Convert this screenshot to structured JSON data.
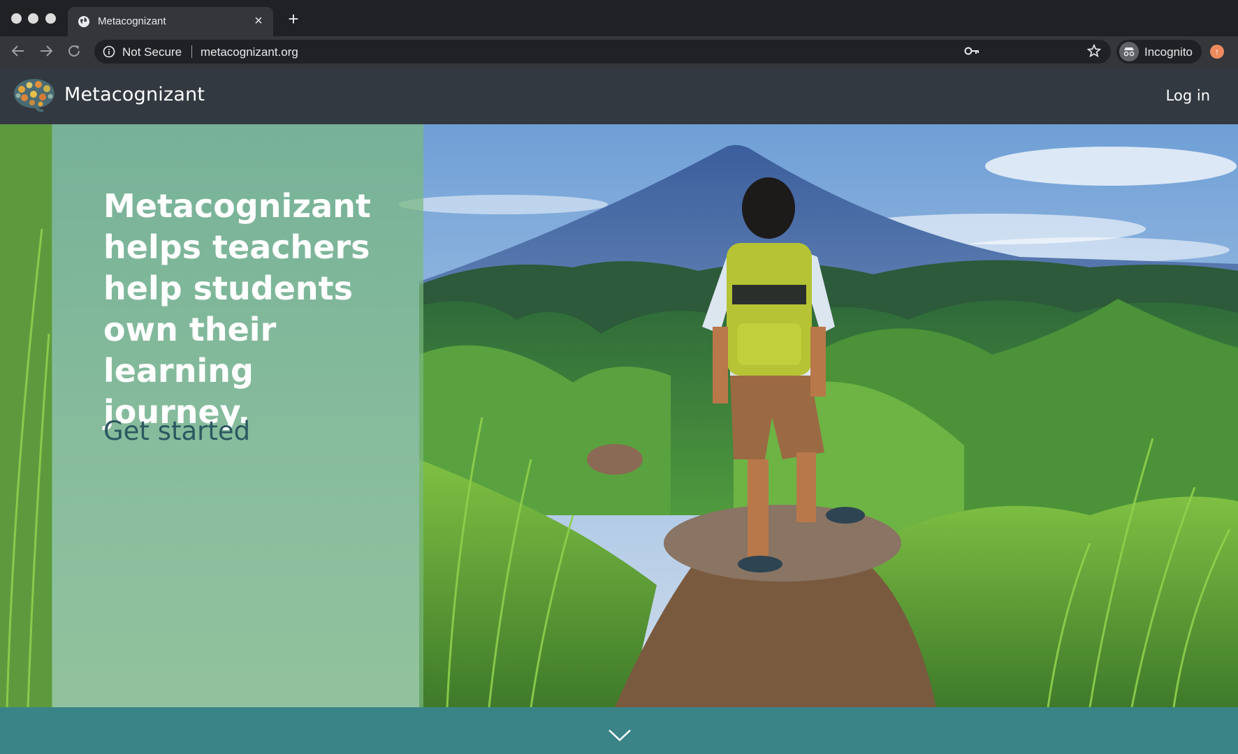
{
  "browser": {
    "tab_title": "Metacognizant",
    "security_label": "Not Secure",
    "url": "metacognizant.org",
    "profile_label": "Incognito"
  },
  "site": {
    "brand": "Metacognizant",
    "login_label": "Log in"
  },
  "hero": {
    "headline": "Metacognizant helps teachers help students own their learning journey.",
    "cta_label": "Get started"
  },
  "colors": {
    "header_bg": "#333940",
    "panel_green": "#7ab980",
    "cta_text": "#2d5760",
    "band_teal": "#3a8487"
  }
}
